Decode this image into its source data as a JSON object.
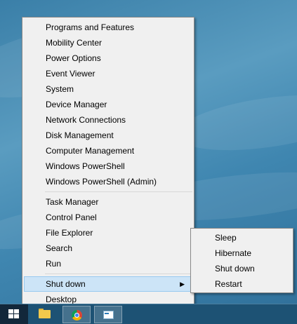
{
  "context_menu": {
    "group1": [
      "Programs and Features",
      "Mobility Center",
      "Power Options",
      "Event Viewer",
      "System",
      "Device Manager",
      "Network Connections",
      "Disk Management",
      "Computer Management",
      "Windows PowerShell",
      "Windows PowerShell (Admin)"
    ],
    "group2": [
      "Task Manager",
      "Control Panel",
      "File Explorer",
      "Search",
      "Run"
    ],
    "shut_down": "Shut down",
    "shut_down_arrow": "▶",
    "desktop": "Desktop"
  },
  "shutdown_submenu": [
    "Sleep",
    "Hibernate",
    "Shut down",
    "Restart"
  ],
  "taskbar": {
    "start_icon": "windows-logo-icon",
    "pinned": [
      "file-explorer-icon",
      "chrome-icon",
      "app-window-icon"
    ]
  },
  "colors": {
    "menu_background": "#f0f0f0",
    "highlight": "#cce4f7",
    "highlight_border": "#99c9ef",
    "taskbar": "#1d5274",
    "start_button": "#12273a"
  }
}
